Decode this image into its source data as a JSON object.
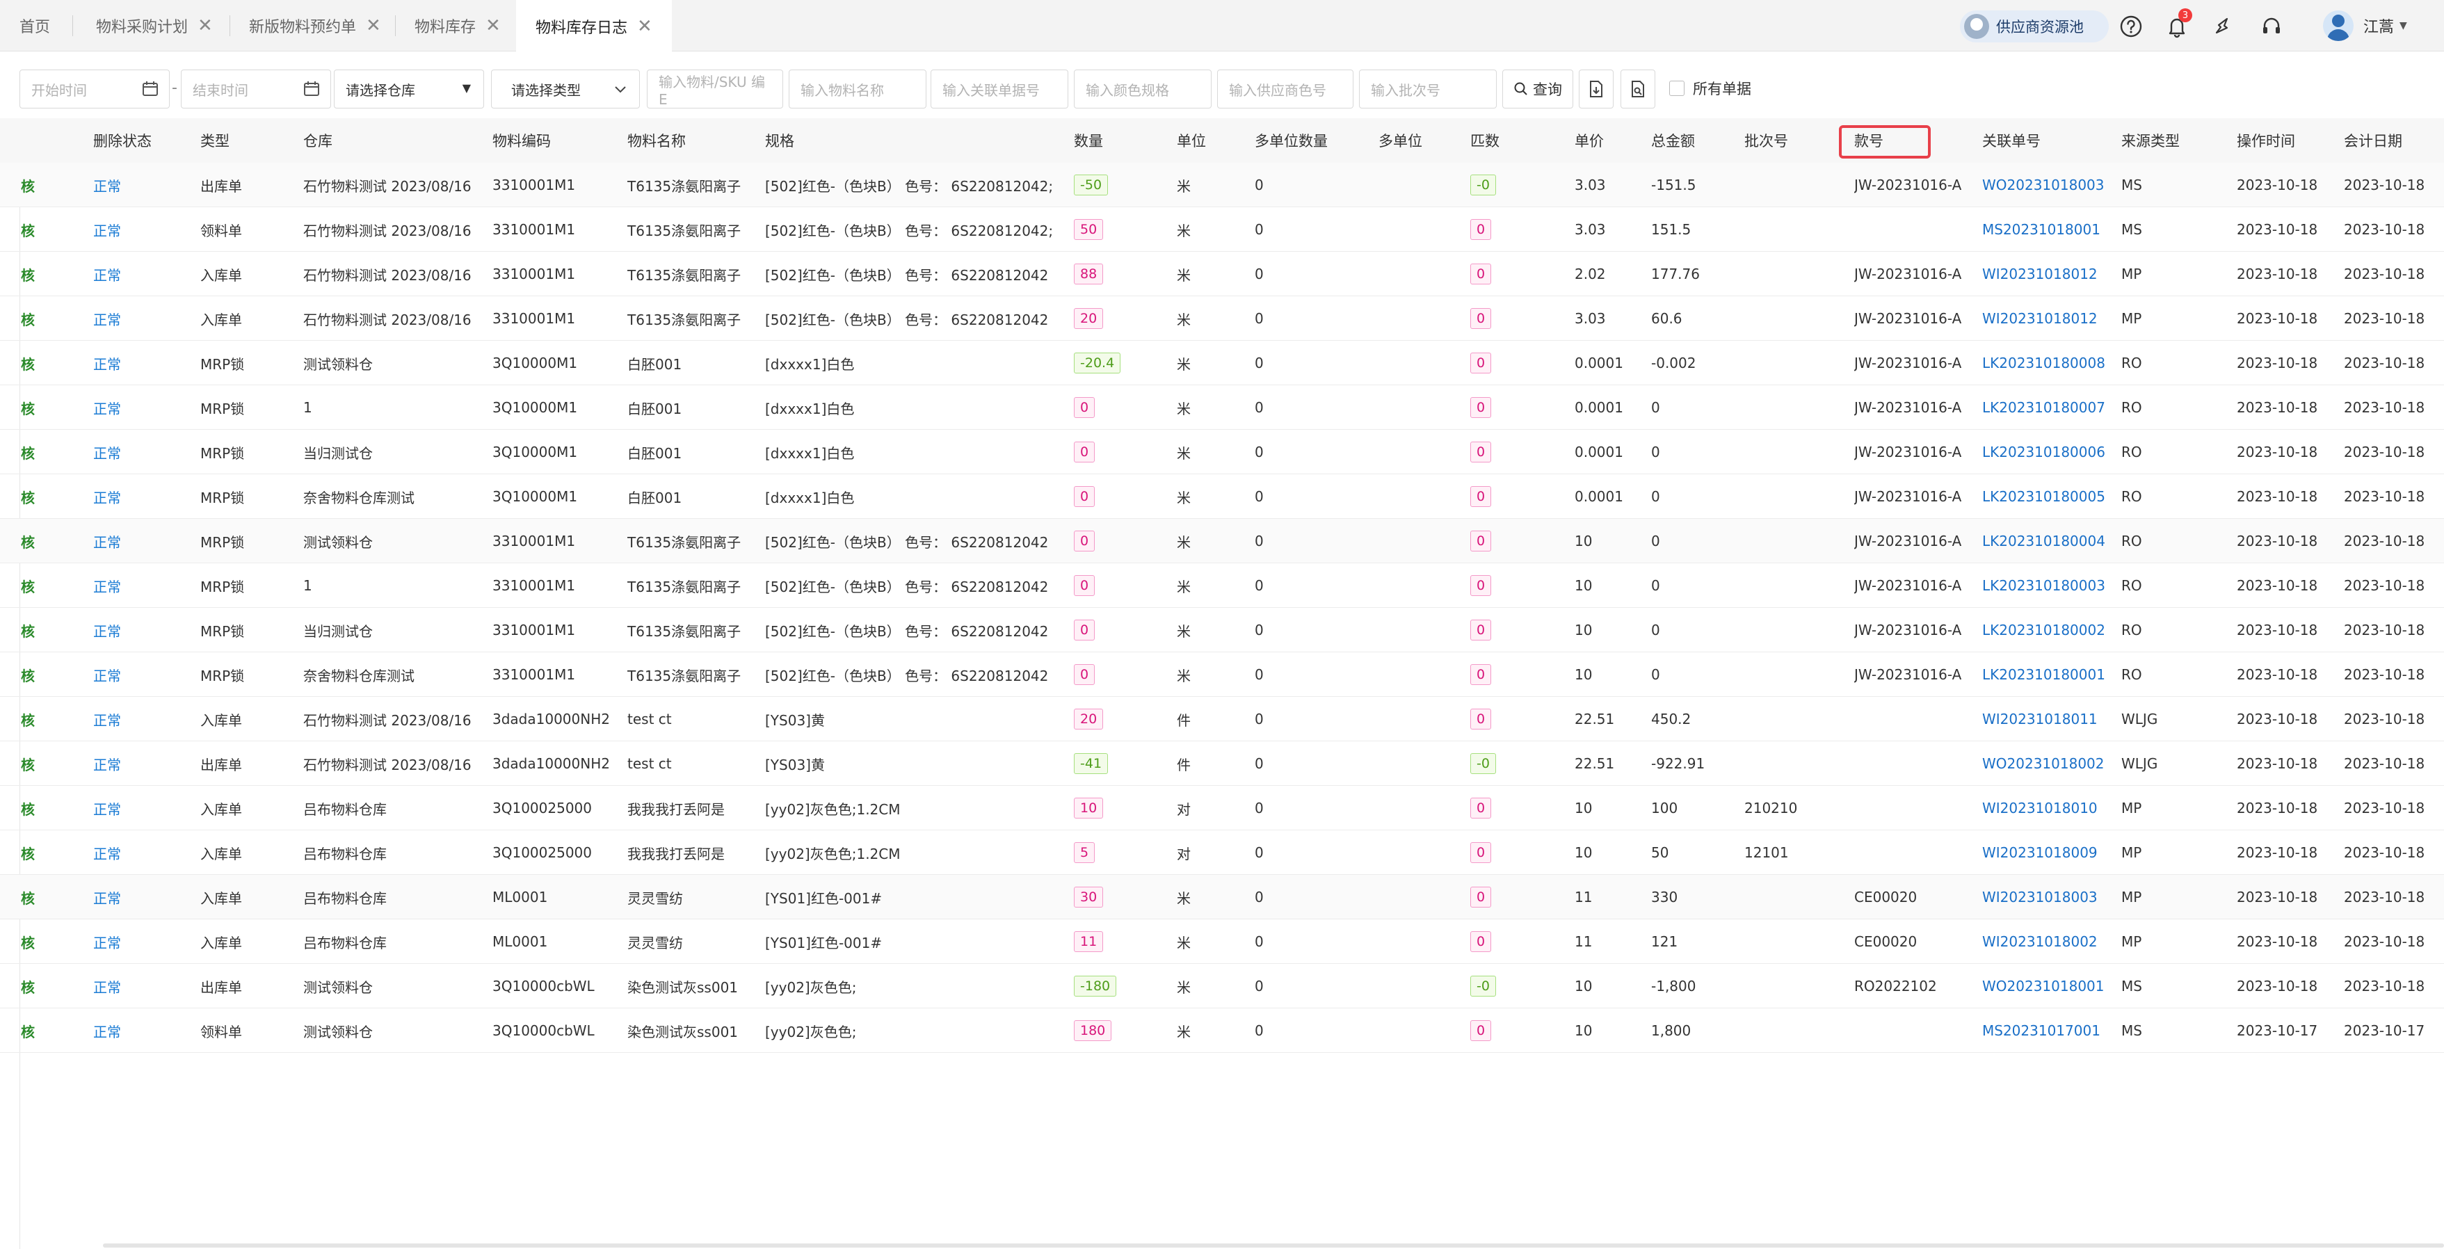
{
  "tabs": [
    {
      "label": "首页",
      "closable": false
    },
    {
      "label": "物料采购计划",
      "closable": true
    },
    {
      "label": "新版物料预约单",
      "closable": true
    },
    {
      "label": "物料库存",
      "closable": true
    },
    {
      "label": "物料库存日志",
      "closable": true,
      "active": true
    }
  ],
  "header": {
    "supplier_pool_label": "供应商资源池",
    "notification_count": "3",
    "user_name": "江蒿",
    "icons": [
      "help-icon",
      "bell-icon",
      "share-icon",
      "headset-icon",
      "user-avatar"
    ]
  },
  "filters": {
    "start_date_placeholder": "开始时间",
    "end_date_placeholder": "结束时间",
    "warehouse_select": "请选择仓库",
    "type_select": "请选择类型",
    "material_sku_placeholder": "输入物料/SKU 编E",
    "material_name_placeholder": "输入物料名称",
    "related_doc_placeholder": "输入关联单据号",
    "color_spec_placeholder": "输入颜色规格",
    "supplier_color_placeholder": "输入供应商色号",
    "batch_placeholder": "输入批次号",
    "query_label": "查询",
    "all_docs_label": "所有单据"
  },
  "columns": [
    "删除状态",
    "类型",
    "仓库",
    "物料编码",
    "物料名称",
    "规格",
    "数量",
    "单位",
    "多单位数量",
    "多单位",
    "匹数",
    "单价",
    "总金额",
    "批次号",
    "款号",
    "关联单号",
    "来源类型",
    "操作时间",
    "会计日期"
  ],
  "row_prefix": "核",
  "rows": [
    {
      "status": "正常",
      "type": "出库单",
      "warehouse": "石竹物料测试 2023/08/16",
      "code": "3310001M1",
      "name": "T6135涤氨阳离子",
      "spec": "[502]红色-（色块B） 色号： 6S220812042;",
      "qty": "-50",
      "qty_sign": "neg",
      "unit": "米",
      "multi_qty": "0",
      "multi_unit": "",
      "pieces": "-0",
      "pieces_sign": "neg",
      "price": "3.03",
      "total": "-151.5",
      "batch": "",
      "style_no": "JW-20231016-A",
      "ref": "WO20231018003",
      "source": "MS",
      "op_date": "2023-10-18",
      "acct_date": "2023-10-18"
    },
    {
      "status": "正常",
      "type": "领料单",
      "warehouse": "石竹物料测试 2023/08/16",
      "code": "3310001M1",
      "name": "T6135涤氨阳离子",
      "spec": "[502]红色-（色块B） 色号： 6S220812042;",
      "qty": "50",
      "qty_sign": "pos",
      "unit": "米",
      "multi_qty": "0",
      "multi_unit": "",
      "pieces": "0",
      "pieces_sign": "pos",
      "price": "3.03",
      "total": "151.5",
      "batch": "",
      "style_no": "",
      "ref": "MS20231018001",
      "source": "MS",
      "op_date": "2023-10-18",
      "acct_date": "2023-10-18"
    },
    {
      "status": "正常",
      "type": "入库单",
      "warehouse": "石竹物料测试 2023/08/16",
      "code": "3310001M1",
      "name": "T6135涤氨阳离子",
      "spec": "[502]红色-（色块B） 色号： 6S220812042",
      "qty": "88",
      "qty_sign": "pos",
      "unit": "米",
      "multi_qty": "0",
      "multi_unit": "",
      "pieces": "0",
      "pieces_sign": "pos",
      "price": "2.02",
      "total": "177.76",
      "batch": "",
      "style_no": "JW-20231016-A",
      "ref": "WI20231018012",
      "source": "MP",
      "op_date": "2023-10-18",
      "acct_date": "2023-10-18"
    },
    {
      "status": "正常",
      "type": "入库单",
      "warehouse": "石竹物料测试 2023/08/16",
      "code": "3310001M1",
      "name": "T6135涤氨阳离子",
      "spec": "[502]红色-（色块B） 色号： 6S220812042",
      "qty": "20",
      "qty_sign": "pos",
      "unit": "米",
      "multi_qty": "0",
      "multi_unit": "",
      "pieces": "0",
      "pieces_sign": "pos",
      "price": "3.03",
      "total": "60.6",
      "batch": "",
      "style_no": "JW-20231016-A",
      "ref": "WI20231018012",
      "source": "MP",
      "op_date": "2023-10-18",
      "acct_date": "2023-10-18"
    },
    {
      "status": "正常",
      "type": "MRP锁",
      "warehouse": "测试领料仓",
      "code": "3Q10000M1",
      "name": "白胚001",
      "spec": "[dxxxx1]白色",
      "qty": "-20.4",
      "qty_sign": "neg",
      "unit": "米",
      "multi_qty": "0",
      "multi_unit": "",
      "pieces": "0",
      "pieces_sign": "pos",
      "price": "0.0001",
      "total": "-0.002",
      "batch": "",
      "style_no": "JW-20231016-A",
      "ref": "LK202310180008",
      "source": "RO",
      "op_date": "2023-10-18",
      "acct_date": "2023-10-18"
    },
    {
      "status": "正常",
      "type": "MRP锁",
      "warehouse": "1",
      "code": "3Q10000M1",
      "name": "白胚001",
      "spec": "[dxxxx1]白色",
      "qty": "0",
      "qty_sign": "pos",
      "unit": "米",
      "multi_qty": "0",
      "multi_unit": "",
      "pieces": "0",
      "pieces_sign": "pos",
      "price": "0.0001",
      "total": "0",
      "batch": "",
      "style_no": "JW-20231016-A",
      "ref": "LK202310180007",
      "source": "RO",
      "op_date": "2023-10-18",
      "acct_date": "2023-10-18"
    },
    {
      "status": "正常",
      "type": "MRP锁",
      "warehouse": "当归测试仓",
      "code": "3Q10000M1",
      "name": "白胚001",
      "spec": "[dxxxx1]白色",
      "qty": "0",
      "qty_sign": "pos",
      "unit": "米",
      "multi_qty": "0",
      "multi_unit": "",
      "pieces": "0",
      "pieces_sign": "pos",
      "price": "0.0001",
      "total": "0",
      "batch": "",
      "style_no": "JW-20231016-A",
      "ref": "LK202310180006",
      "source": "RO",
      "op_date": "2023-10-18",
      "acct_date": "2023-10-18"
    },
    {
      "status": "正常",
      "type": "MRP锁",
      "warehouse": "奈舍物料仓库测试",
      "code": "3Q10000M1",
      "name": "白胚001",
      "spec": "[dxxxx1]白色",
      "qty": "0",
      "qty_sign": "pos",
      "unit": "米",
      "multi_qty": "0",
      "multi_unit": "",
      "pieces": "0",
      "pieces_sign": "pos",
      "price": "0.0001",
      "total": "0",
      "batch": "",
      "style_no": "JW-20231016-A",
      "ref": "LK202310180005",
      "source": "RO",
      "op_date": "2023-10-18",
      "acct_date": "2023-10-18"
    },
    {
      "status": "正常",
      "type": "MRP锁",
      "warehouse": "测试领料仓",
      "code": "3310001M1",
      "name": "T6135涤氨阳离子",
      "spec": "[502]红色-（色块B） 色号： 6S220812042",
      "qty": "0",
      "qty_sign": "pos",
      "unit": "米",
      "multi_qty": "0",
      "multi_unit": "",
      "pieces": "0",
      "pieces_sign": "pos",
      "price": "10",
      "total": "0",
      "batch": "",
      "style_no": "JW-20231016-A",
      "ref": "LK202310180004",
      "source": "RO",
      "op_date": "2023-10-18",
      "acct_date": "2023-10-18"
    },
    {
      "status": "正常",
      "type": "MRP锁",
      "warehouse": "1",
      "code": "3310001M1",
      "name": "T6135涤氨阳离子",
      "spec": "[502]红色-（色块B） 色号： 6S220812042",
      "qty": "0",
      "qty_sign": "pos",
      "unit": "米",
      "multi_qty": "0",
      "multi_unit": "",
      "pieces": "0",
      "pieces_sign": "pos",
      "price": "10",
      "total": "0",
      "batch": "",
      "style_no": "JW-20231016-A",
      "ref": "LK202310180003",
      "source": "RO",
      "op_date": "2023-10-18",
      "acct_date": "2023-10-18"
    },
    {
      "status": "正常",
      "type": "MRP锁",
      "warehouse": "当归测试仓",
      "code": "3310001M1",
      "name": "T6135涤氨阳离子",
      "spec": "[502]红色-（色块B） 色号： 6S220812042",
      "qty": "0",
      "qty_sign": "pos",
      "unit": "米",
      "multi_qty": "0",
      "multi_unit": "",
      "pieces": "0",
      "pieces_sign": "pos",
      "price": "10",
      "total": "0",
      "batch": "",
      "style_no": "JW-20231016-A",
      "ref": "LK202310180002",
      "source": "RO",
      "op_date": "2023-10-18",
      "acct_date": "2023-10-18"
    },
    {
      "status": "正常",
      "type": "MRP锁",
      "warehouse": "奈舍物料仓库测试",
      "code": "3310001M1",
      "name": "T6135涤氨阳离子",
      "spec": "[502]红色-（色块B） 色号： 6S220812042",
      "qty": "0",
      "qty_sign": "pos",
      "unit": "米",
      "multi_qty": "0",
      "multi_unit": "",
      "pieces": "0",
      "pieces_sign": "pos",
      "price": "10",
      "total": "0",
      "batch": "",
      "style_no": "JW-20231016-A",
      "ref": "LK202310180001",
      "source": "RO",
      "op_date": "2023-10-18",
      "acct_date": "2023-10-18"
    },
    {
      "status": "正常",
      "type": "入库单",
      "warehouse": "石竹物料测试 2023/08/16",
      "code": "3dada10000NH2",
      "name": "test ct",
      "spec": "[YS03]黄",
      "qty": "20",
      "qty_sign": "pos",
      "unit": "件",
      "multi_qty": "0",
      "multi_unit": "",
      "pieces": "0",
      "pieces_sign": "pos",
      "price": "22.51",
      "total": "450.2",
      "batch": "",
      "style_no": "",
      "ref": "WI20231018011",
      "source": "WLJG",
      "op_date": "2023-10-18",
      "acct_date": "2023-10-18"
    },
    {
      "status": "正常",
      "type": "出库单",
      "warehouse": "石竹物料测试 2023/08/16",
      "code": "3dada10000NH2",
      "name": "test ct",
      "spec": "[YS03]黄",
      "qty": "-41",
      "qty_sign": "neg",
      "unit": "件",
      "multi_qty": "0",
      "multi_unit": "",
      "pieces": "-0",
      "pieces_sign": "neg",
      "price": "22.51",
      "total": "-922.91",
      "batch": "",
      "style_no": "",
      "ref": "WO20231018002",
      "source": "WLJG",
      "op_date": "2023-10-18",
      "acct_date": "2023-10-18"
    },
    {
      "status": "正常",
      "type": "入库单",
      "warehouse": "吕布物料仓库",
      "code": "3Q100025000",
      "name": "我我我打丢阿是",
      "spec": "[yy02]灰色色;1.2CM",
      "qty": "10",
      "qty_sign": "pos",
      "unit": "对",
      "multi_qty": "0",
      "multi_unit": "",
      "pieces": "0",
      "pieces_sign": "pos",
      "price": "10",
      "total": "100",
      "batch": "210210",
      "style_no": "",
      "ref": "WI20231018010",
      "source": "MP",
      "op_date": "2023-10-18",
      "acct_date": "2023-10-18"
    },
    {
      "status": "正常",
      "type": "入库单",
      "warehouse": "吕布物料仓库",
      "code": "3Q100025000",
      "name": "我我我打丢阿是",
      "spec": "[yy02]灰色色;1.2CM",
      "qty": "5",
      "qty_sign": "pos",
      "unit": "对",
      "multi_qty": "0",
      "multi_unit": "",
      "pieces": "0",
      "pieces_sign": "pos",
      "price": "10",
      "total": "50",
      "batch": "12101",
      "style_no": "",
      "ref": "WI20231018009",
      "source": "MP",
      "op_date": "2023-10-18",
      "acct_date": "2023-10-18"
    },
    {
      "status": "正常",
      "type": "入库单",
      "warehouse": "吕布物料仓库",
      "code": "ML0001",
      "name": "灵灵雪纺",
      "spec": "[YS01]红色-001#",
      "qty": "30",
      "qty_sign": "pos",
      "unit": "米",
      "multi_qty": "0",
      "multi_unit": "",
      "pieces": "0",
      "pieces_sign": "pos",
      "price": "11",
      "total": "330",
      "batch": "",
      "style_no": "CE00020",
      "ref": "WI20231018003",
      "source": "MP",
      "op_date": "2023-10-18",
      "acct_date": "2023-10-18"
    },
    {
      "status": "正常",
      "type": "入库单",
      "warehouse": "吕布物料仓库",
      "code": "ML0001",
      "name": "灵灵雪纺",
      "spec": "[YS01]红色-001#",
      "qty": "11",
      "qty_sign": "pos",
      "unit": "米",
      "multi_qty": "0",
      "multi_unit": "",
      "pieces": "0",
      "pieces_sign": "pos",
      "price": "11",
      "total": "121",
      "batch": "",
      "style_no": "CE00020",
      "ref": "WI20231018002",
      "source": "MP",
      "op_date": "2023-10-18",
      "acct_date": "2023-10-18"
    },
    {
      "status": "正常",
      "type": "出库单",
      "warehouse": "测试领料仓",
      "code": "3Q10000cbWL",
      "name": "染色测试灰ss001",
      "spec": "[yy02]灰色色;",
      "qty": "-180",
      "qty_sign": "neg",
      "unit": "米",
      "multi_qty": "0",
      "multi_unit": "",
      "pieces": "-0",
      "pieces_sign": "neg",
      "price": "10",
      "total": "-1,800",
      "batch": "",
      "style_no": "RO2022102",
      "ref": "WO20231018001",
      "source": "MS",
      "op_date": "2023-10-18",
      "acct_date": "2023-10-18"
    },
    {
      "status": "正常",
      "type": "领料单",
      "warehouse": "测试领料仓",
      "code": "3Q10000cbWL",
      "name": "染色测试灰ss001",
      "spec": "[yy02]灰色色;",
      "qty": "180",
      "qty_sign": "pos",
      "unit": "米",
      "multi_qty": "0",
      "multi_unit": "",
      "pieces": "0",
      "pieces_sign": "pos",
      "price": "10",
      "total": "1,800",
      "batch": "",
      "style_no": "",
      "ref": "MS20231017001",
      "source": "MS",
      "op_date": "2023-10-17",
      "acct_date": "2023-10-17"
    }
  ]
}
